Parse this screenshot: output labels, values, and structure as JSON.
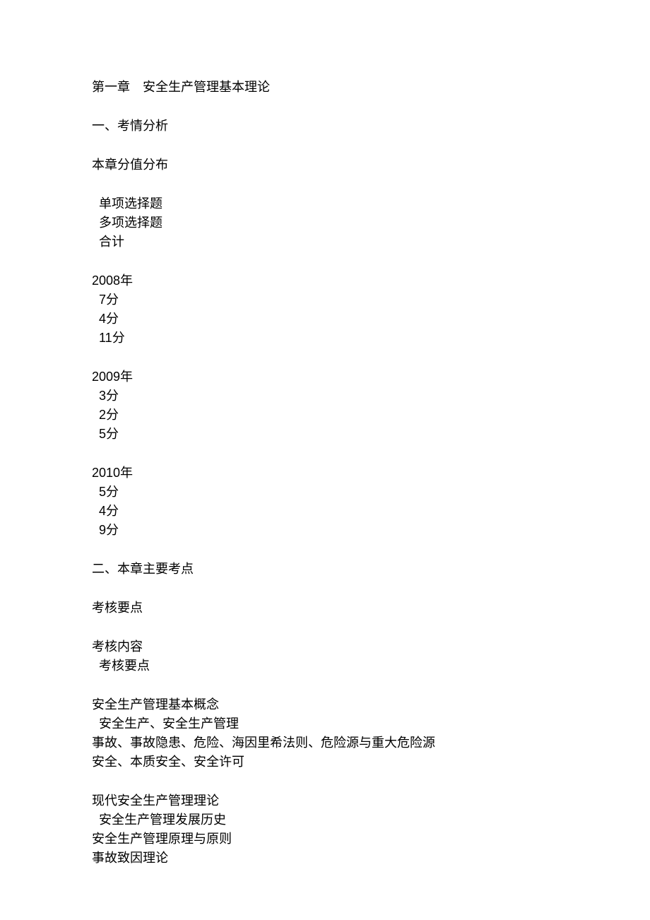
{
  "title": "第一章　安全生产管理基本理论",
  "section1": {
    "heading": "一、考情分析",
    "subheading": "本章分值分布",
    "headers": {
      "h1": "单项选择题",
      "h2": "多项选择题",
      "h3": "合计"
    },
    "years": [
      {
        "label_num": "2008",
        "label_suffix": "年",
        "r1_num": "7",
        "r1_suffix": "分",
        "r2_num": "4",
        "r2_suffix": "分",
        "r3_num": "11",
        "r3_suffix": "分"
      },
      {
        "label_num": "2009",
        "label_suffix": "年",
        "r1_num": "3",
        "r1_suffix": "分",
        "r2_num": "2",
        "r2_suffix": "分",
        "r3_num": "5",
        "r3_suffix": "分"
      },
      {
        "label_num": "2010",
        "label_suffix": "年",
        "r1_num": "5",
        "r1_suffix": "分",
        "r2_num": "4",
        "r2_suffix": "分",
        "r3_num": "9",
        "r3_suffix": "分"
      }
    ]
  },
  "section2": {
    "heading": "二、本章主要考点",
    "subheading": "考核要点",
    "col1": "考核内容",
    "col2": "考核要点",
    "group1": {
      "title": "安全生产管理基本概念",
      "l1": "安全生产、安全生产管理",
      "l2": "事故、事故隐患、危险、海因里希法则、危险源与重大危险源",
      "l3": "安全、本质安全、安全许可"
    },
    "group2": {
      "title": "现代安全生产管理理论",
      "l1": "安全生产管理发展历史",
      "l2": "安全生产管理原理与原则",
      "l3": "事故致因理论"
    }
  }
}
